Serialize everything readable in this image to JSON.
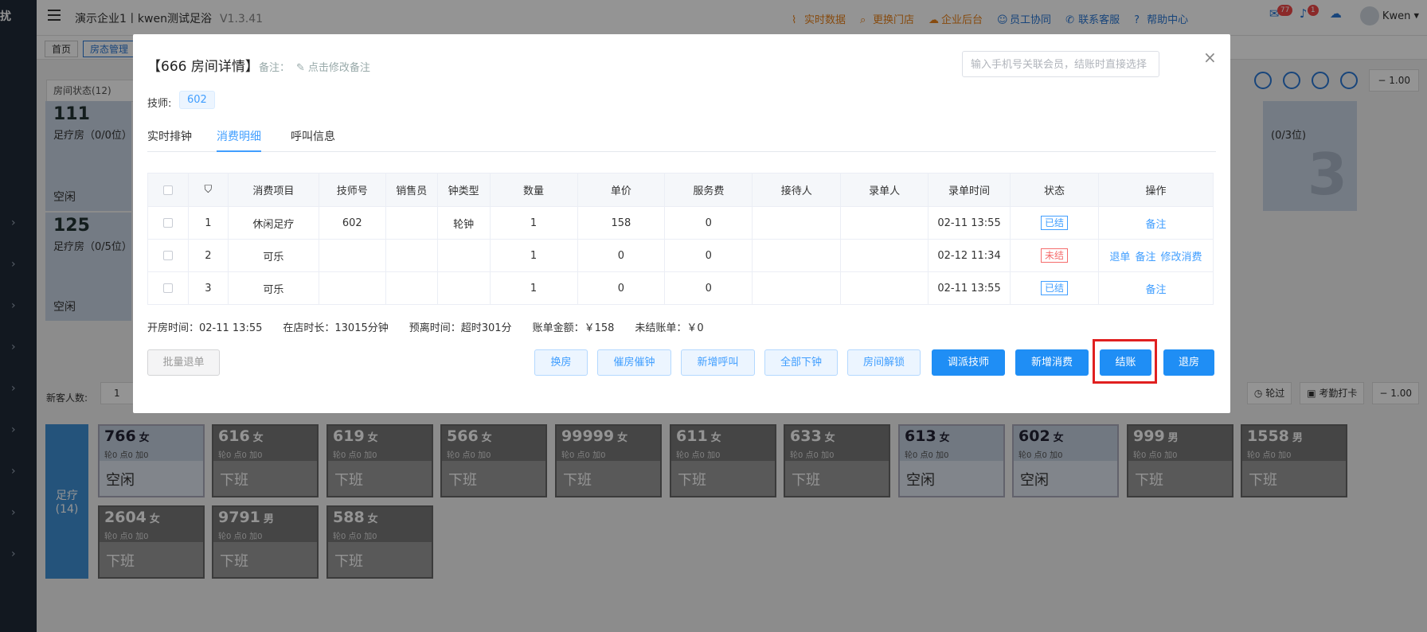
{
  "app": {
    "logo": "扰",
    "title": "演示企业1丨kwen测试足浴",
    "version": "V1.3.41",
    "nav": [
      {
        "label": "实时数据",
        "icon": "chart-icon",
        "color": "orange"
      },
      {
        "label": "更换门店",
        "icon": "search-icon",
        "color": "orange"
      },
      {
        "label": "企业后台",
        "icon": "cloud-icon",
        "color": "orange"
      },
      {
        "label": "员工协同",
        "icon": "users-icon",
        "color": "blue"
      },
      {
        "label": "联系客服",
        "icon": "phone-icon",
        "color": "blue"
      },
      {
        "label": "帮助中心",
        "icon": "help-icon",
        "color": "blue"
      }
    ],
    "mail_count": "77",
    "notif_count": "1",
    "user": "Kwen",
    "tabs": [
      "首页",
      "房态管理"
    ],
    "room_filter": "房间状态(12)",
    "rooms": [
      {
        "num": "111",
        "type": "足疗房（0/0位）",
        "state": "空闲"
      },
      {
        "num": "125",
        "type": "足疗房（0/5位）",
        "state": "空闲"
      }
    ],
    "right_room": {
      "type": "(0/3位)",
      "big": "3"
    },
    "zoom_value": "1.00",
    "guest_label": "新客人数:",
    "guest_count": "1",
    "tool_round": "轮过",
    "tool_clock": "考勤打卡",
    "tech_group": {
      "name": "足疗",
      "count": "(14)"
    },
    "techs": [
      {
        "num": "766",
        "sex": "女",
        "sub": "轮0 点0 加0",
        "state": "空闲",
        "free": true
      },
      {
        "num": "616",
        "sex": "女",
        "sub": "轮0 点0 加0",
        "state": "下班",
        "free": false
      },
      {
        "num": "619",
        "sex": "女",
        "sub": "轮0 点0 加0",
        "state": "下班",
        "free": false
      },
      {
        "num": "566",
        "sex": "女",
        "sub": "轮0 点0 加0",
        "state": "下班",
        "free": false
      },
      {
        "num": "99999",
        "sex": "女",
        "sub": "轮0 点0 加0",
        "state": "下班",
        "free": false
      },
      {
        "num": "611",
        "sex": "女",
        "sub": "轮0 点0 加0",
        "state": "下班",
        "free": false
      },
      {
        "num": "633",
        "sex": "女",
        "sub": "轮0 点0 加0",
        "state": "下班",
        "free": false
      },
      {
        "num": "613",
        "sex": "女",
        "sub": "轮0 点0 加0",
        "state": "空闲",
        "free": true
      },
      {
        "num": "602",
        "sex": "女",
        "sub": "轮0 点0 加0",
        "state": "空闲",
        "free": true
      },
      {
        "num": "999",
        "sex": "男",
        "sub": "轮0 点0 加0",
        "state": "下班",
        "free": false
      },
      {
        "num": "1558",
        "sex": "男",
        "sub": "轮0 点0 加0",
        "state": "下班",
        "free": false
      },
      {
        "num": "2604",
        "sex": "女",
        "sub": "轮0 点0 加0",
        "state": "下班",
        "free": false
      },
      {
        "num": "9791",
        "sex": "男",
        "sub": "轮0 点0 加0",
        "state": "下班",
        "free": false
      },
      {
        "num": "588",
        "sex": "女",
        "sub": "轮0 点0 加0",
        "state": "下班",
        "free": false
      }
    ]
  },
  "modal": {
    "title": "【666 房间详情】",
    "note_label": "备注：",
    "note_action": "点击修改备注",
    "search_placeholder": "输入手机号关联会员，结账时直接选择",
    "close": "×",
    "tech_label": "技师:",
    "tech_tag": "602",
    "tabs": [
      {
        "label": "实时排钟",
        "active": false
      },
      {
        "label": "消费明细",
        "active": true
      },
      {
        "label": "呼叫信息",
        "active": false
      }
    ],
    "columns": [
      "",
      "",
      "消费项目",
      "技师号",
      "销售员",
      "钟类型",
      "数量",
      "单价",
      "服务费",
      "接待人",
      "录单人",
      "录单时间",
      "状态",
      "操作"
    ],
    "rows": [
      {
        "idx": "1",
        "item": "休闲足疗",
        "tech": "602",
        "seller": "",
        "clock": "轮钟",
        "qty": "1",
        "price": "158",
        "fee": "0",
        "host": "",
        "recorder": "",
        "time": "02-11 13:55",
        "status": "已结",
        "paid": true,
        "ops": [
          "备注"
        ]
      },
      {
        "idx": "2",
        "item": "可乐",
        "tech": "",
        "seller": "",
        "clock": "",
        "qty": "1",
        "price": "0",
        "fee": "0",
        "host": "",
        "recorder": "",
        "time": "02-12 11:34",
        "status": "未结",
        "paid": false,
        "ops": [
          "退单",
          "备注",
          "修改消费"
        ]
      },
      {
        "idx": "3",
        "item": "可乐",
        "tech": "",
        "seller": "",
        "clock": "",
        "qty": "1",
        "price": "0",
        "fee": "0",
        "host": "",
        "recorder": "",
        "time": "02-11 13:55",
        "status": "已结",
        "paid": true,
        "ops": [
          "备注"
        ]
      }
    ],
    "summary": [
      "开房时间：02-11 13:55",
      "在店时长：13015分钟",
      "预离时间：超时301分",
      "账单金额：￥158",
      "未结账单：￥0"
    ],
    "buttons": {
      "batch_refund": "批量退单",
      "change_room": "换房",
      "urge": "催房催钟",
      "new_call": "新增呼叫",
      "all_down": "全部下钟",
      "unlock": "房间解锁",
      "dispatch": "调派技师",
      "add_consume": "新增消费",
      "checkout": "结账",
      "leave": "退房"
    }
  }
}
